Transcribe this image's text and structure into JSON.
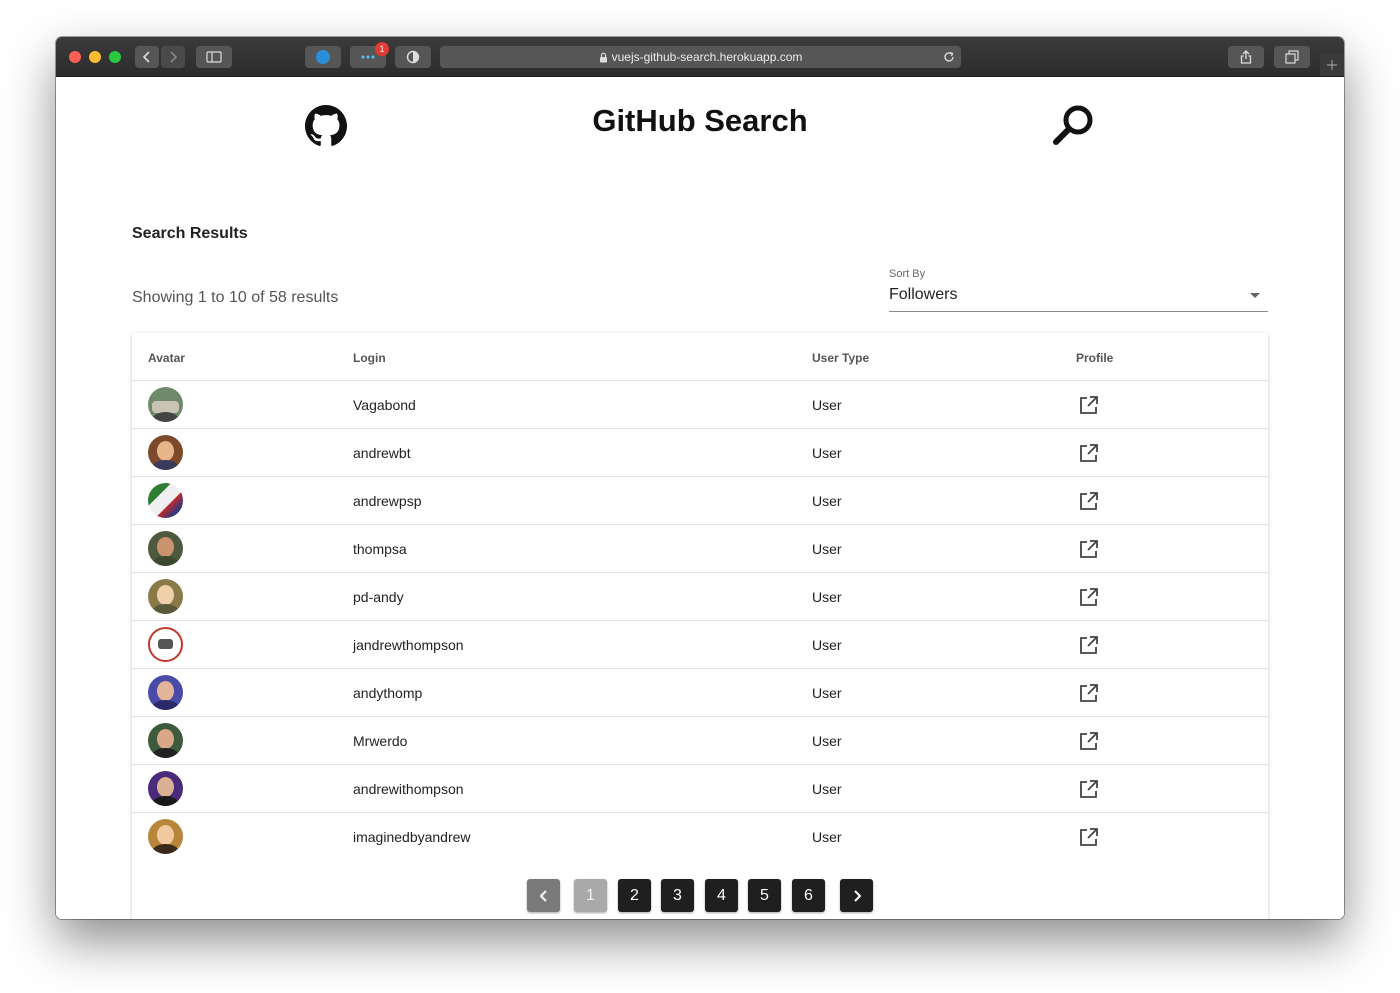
{
  "browser": {
    "url": "vuejs-github-search.herokuapp.com",
    "extension_badge_count": "1"
  },
  "header": {
    "title": "GitHub Search"
  },
  "results": {
    "section_title": "Search Results",
    "summary": "Showing 1 to 10 of 58 results"
  },
  "sort": {
    "label": "Sort By",
    "value": "Followers"
  },
  "table": {
    "columns": [
      "Avatar",
      "Login",
      "User Type",
      "Profile"
    ],
    "rows": [
      {
        "login": "Vagabond",
        "type": "User"
      },
      {
        "login": "andrewbt",
        "type": "User"
      },
      {
        "login": "andrewpsp",
        "type": "User"
      },
      {
        "login": "thompsa",
        "type": "User"
      },
      {
        "login": "pd-andy",
        "type": "User"
      },
      {
        "login": "jandrewthompson",
        "type": "User"
      },
      {
        "login": "andythomp",
        "type": "User"
      },
      {
        "login": "Mrwerdo",
        "type": "User"
      },
      {
        "login": "andrewithompson",
        "type": "User"
      },
      {
        "login": "imaginedbyandrew",
        "type": "User"
      }
    ]
  },
  "pagination": {
    "pages": [
      "1",
      "2",
      "3",
      "4",
      "5",
      "6"
    ],
    "current_page": "1"
  }
}
